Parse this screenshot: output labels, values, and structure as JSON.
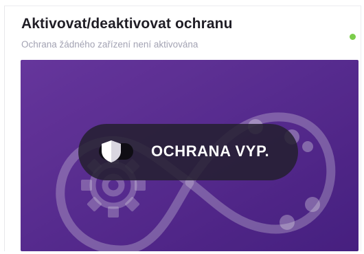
{
  "card": {
    "title": "Aktivovat/deaktivovat ochranu",
    "subtitle": "Ochrana žádného zařízení není aktivována",
    "status_color": "#7ccd4b"
  },
  "banner": {
    "gradient_start": "#6d3aa6",
    "gradient_end": "#4a2187",
    "illustration_icons": [
      "gear-icon",
      "infinity-loop-icon"
    ]
  },
  "protection_toggle": {
    "label": "OCHRANA VYP.",
    "state": "off",
    "knob_icon": "shield-icon"
  }
}
